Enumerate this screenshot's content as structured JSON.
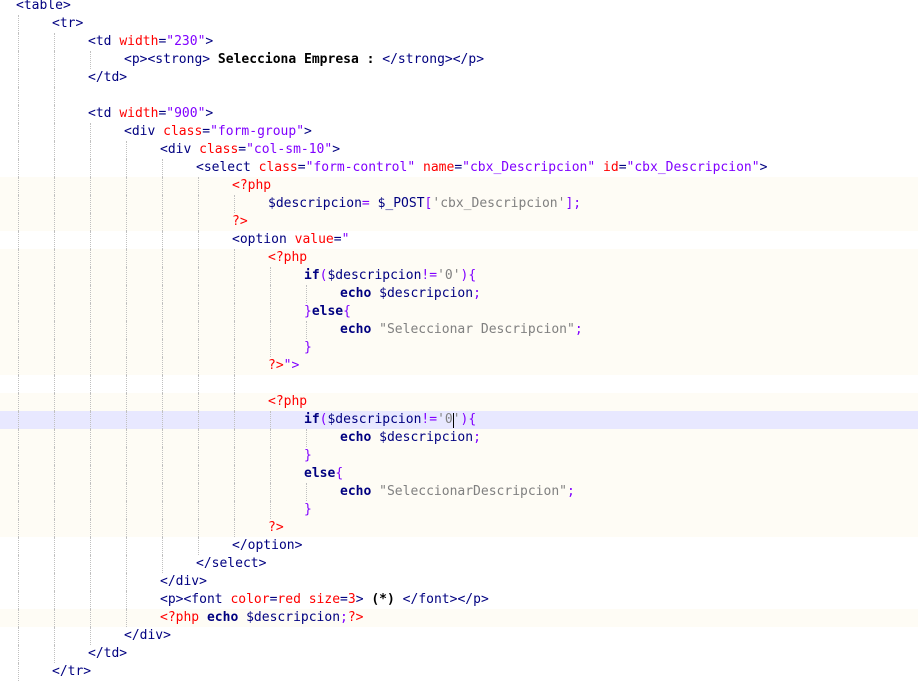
{
  "editor": {
    "lines": [
      [
        {
          "t": "<table>",
          "k": "tag"
        }
      ],
      [
        {
          "t": "<tr>",
          "k": "tag"
        }
      ],
      [
        {
          "t": "<td ",
          "k": "tag"
        },
        {
          "t": "width",
          "k": "attr"
        },
        {
          "t": "=",
          "k": "tag"
        },
        {
          "t": "\"230\"",
          "k": "str"
        },
        {
          "t": ">",
          "k": "tag"
        }
      ],
      [
        {
          "t": "<p><strong>",
          "k": "tag"
        },
        {
          "t": " Selecciona Empresa : ",
          "k": "text"
        },
        {
          "t": "</strong></p>",
          "k": "tag"
        }
      ],
      [
        {
          "t": "</td>",
          "k": "tag"
        }
      ],
      [],
      [
        {
          "t": "<td ",
          "k": "tag"
        },
        {
          "t": "width",
          "k": "attr"
        },
        {
          "t": "=",
          "k": "tag"
        },
        {
          "t": "\"900\"",
          "k": "str"
        },
        {
          "t": ">",
          "k": "tag"
        }
      ],
      [
        {
          "t": "<div ",
          "k": "tag"
        },
        {
          "t": "class",
          "k": "attr"
        },
        {
          "t": "=",
          "k": "tag"
        },
        {
          "t": "\"form-group\"",
          "k": "str"
        },
        {
          "t": ">",
          "k": "tag"
        }
      ],
      [
        {
          "t": "<div ",
          "k": "tag"
        },
        {
          "t": "class",
          "k": "attr"
        },
        {
          "t": "=",
          "k": "tag"
        },
        {
          "t": "\"col-sm-10\"",
          "k": "str"
        },
        {
          "t": ">",
          "k": "tag"
        }
      ],
      [
        {
          "t": "<select ",
          "k": "tag"
        },
        {
          "t": "class",
          "k": "attr"
        },
        {
          "t": "=",
          "k": "tag"
        },
        {
          "t": "\"form-control\"",
          "k": "str"
        },
        {
          "t": " name",
          "k": "attr"
        },
        {
          "t": "=",
          "k": "tag"
        },
        {
          "t": "\"cbx_Descripcion\"",
          "k": "str"
        },
        {
          "t": " id",
          "k": "attr"
        },
        {
          "t": "=",
          "k": "tag"
        },
        {
          "t": "\"cbx_Descripcion\"",
          "k": "str"
        },
        {
          "t": ">",
          "k": "tag"
        }
      ],
      [
        {
          "t": "<?php",
          "k": "php"
        }
      ],
      [
        {
          "t": "$descripcion",
          "k": "var"
        },
        {
          "t": "= ",
          "k": "op"
        },
        {
          "t": "$_POST",
          "k": "var"
        },
        {
          "t": "[",
          "k": "op"
        },
        {
          "t": "'cbx_Descripcion'",
          "k": "sq"
        },
        {
          "t": "];",
          "k": "op"
        }
      ],
      [
        {
          "t": "?>",
          "k": "php"
        }
      ],
      [
        {
          "t": "<option ",
          "k": "tag"
        },
        {
          "t": "value",
          "k": "attr"
        },
        {
          "t": "=",
          "k": "tag"
        },
        {
          "t": "\"",
          "k": "str"
        }
      ],
      [
        {
          "t": "<?php",
          "k": "php"
        }
      ],
      [
        {
          "t": "if",
          "k": "kw"
        },
        {
          "t": "(",
          "k": "op"
        },
        {
          "t": "$descripcion",
          "k": "var"
        },
        {
          "t": "!=",
          "k": "op"
        },
        {
          "t": "'0'",
          "k": "sq"
        },
        {
          "t": "){",
          "k": "op"
        }
      ],
      [
        {
          "t": "echo",
          "k": "kw"
        },
        {
          "t": " $descripcion",
          "k": "var"
        },
        {
          "t": ";",
          "k": "op"
        }
      ],
      [
        {
          "t": "}",
          "k": "op"
        },
        {
          "t": "else",
          "k": "kw"
        },
        {
          "t": "{",
          "k": "op"
        }
      ],
      [
        {
          "t": "echo",
          "k": "kw"
        },
        {
          "t": " ",
          "k": "bl"
        },
        {
          "t": "\"Seleccionar Descripcion\"",
          "k": "sq"
        },
        {
          "t": ";",
          "k": "op"
        }
      ],
      [
        {
          "t": "}",
          "k": "op"
        }
      ],
      [
        {
          "t": "?>",
          "k": "php"
        },
        {
          "t": "\">",
          "k": "str"
        }
      ],
      [],
      [
        {
          "t": "<?php",
          "k": "php"
        }
      ],
      [
        {
          "t": "if",
          "k": "kw"
        },
        {
          "t": "(",
          "k": "op"
        },
        {
          "t": "$descripcion",
          "k": "var"
        },
        {
          "t": "!=",
          "k": "op"
        },
        {
          "t": "'0'",
          "k": "sq"
        },
        {
          "t": "){",
          "k": "op"
        }
      ],
      [
        {
          "t": "echo",
          "k": "kw"
        },
        {
          "t": " $descripcion",
          "k": "var"
        },
        {
          "t": ";",
          "k": "op"
        }
      ],
      [
        {
          "t": "}",
          "k": "op"
        }
      ],
      [
        {
          "t": "else",
          "k": "kw"
        },
        {
          "t": "{",
          "k": "op"
        }
      ],
      [
        {
          "t": "echo",
          "k": "kw"
        },
        {
          "t": " ",
          "k": "bl"
        },
        {
          "t": "\"SeleccionarDescripcion\"",
          "k": "sq"
        },
        {
          "t": ";",
          "k": "op"
        }
      ],
      [
        {
          "t": "}",
          "k": "op"
        }
      ],
      [
        {
          "t": "?>",
          "k": "php"
        }
      ],
      [
        {
          "t": "</option>",
          "k": "tag"
        }
      ],
      [
        {
          "t": "</select>",
          "k": "tag"
        }
      ],
      [
        {
          "t": "</div>",
          "k": "tag"
        }
      ],
      [
        {
          "t": "<p><font ",
          "k": "tag"
        },
        {
          "t": "color",
          "k": "attr"
        },
        {
          "t": "=",
          "k": "tag"
        },
        {
          "t": "red",
          "k": "attr"
        },
        {
          "t": " size",
          "k": "attr"
        },
        {
          "t": "=",
          "k": "tag"
        },
        {
          "t": "3",
          "k": "attr"
        },
        {
          "t": ">",
          "k": "tag"
        },
        {
          "t": " (*) ",
          "k": "text"
        },
        {
          "t": "</font></p>",
          "k": "tag"
        }
      ],
      [
        {
          "t": "<?php",
          "k": "php"
        },
        {
          "t": " echo",
          "k": "kw"
        },
        {
          "t": " $descripcion",
          "k": "var"
        },
        {
          "t": ";",
          "k": "op"
        },
        {
          "t": "?>",
          "k": "php"
        }
      ],
      [
        {
          "t": "</div>",
          "k": "tag"
        }
      ],
      [
        {
          "t": "</td>",
          "k": "tag"
        }
      ],
      [
        {
          "t": "</tr>",
          "k": "tag"
        }
      ],
      []
    ]
  }
}
